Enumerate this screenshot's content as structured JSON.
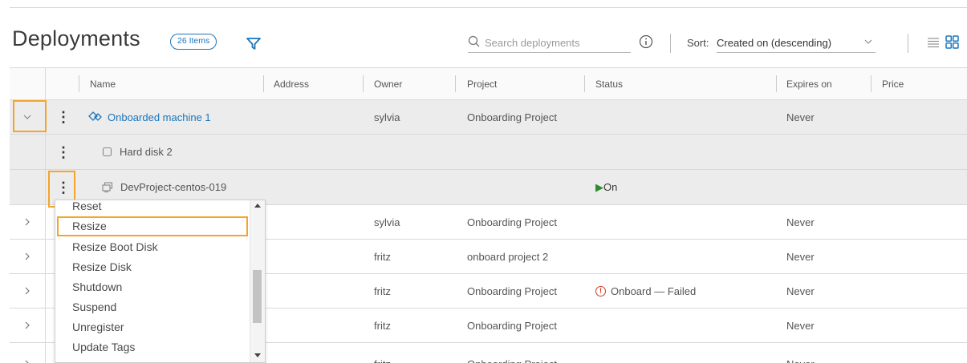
{
  "header": {
    "title": "Deployments",
    "count_badge": "26 Items",
    "search_placeholder": "Search deployments",
    "sort_label": "Sort:",
    "sort_value": "Created on (descending)"
  },
  "columns": [
    "Name",
    "Address",
    "Owner",
    "Project",
    "Status",
    "Expires on",
    "Price"
  ],
  "rows": [
    {
      "name": "Onboarded machine 1",
      "owner": "sylvia",
      "project": "Onboarding Project",
      "status": "",
      "expires": "Never"
    },
    {
      "name": "Hard disk 2"
    },
    {
      "name": "DevProject-centos-019",
      "status": "On"
    },
    {
      "owner": "sylvia",
      "project": "Onboarding Project",
      "status": "",
      "expires": "Never"
    },
    {
      "owner": "fritz",
      "project": "onboard project 2",
      "status": "",
      "expires": "Never"
    },
    {
      "owner": "fritz",
      "project": "Onboarding Project",
      "status": "Onboard — Failed",
      "expires": "Never"
    },
    {
      "owner": "fritz",
      "project": "Onboarding Project",
      "status": "",
      "expires": "Never"
    },
    {
      "owner": "fritz",
      "project": "Onboarding Project",
      "status": "",
      "expires": "Never"
    }
  ],
  "menu": {
    "items": [
      "Reset",
      "Resize",
      "Resize Boot Disk",
      "Resize Disk",
      "Shutdown",
      "Suspend",
      "Unregister",
      "Update Tags"
    ],
    "highlighted": "Resize"
  },
  "colors": {
    "accent": "#1b75bb",
    "highlight": "#f4a52b",
    "status_on": "#2e8b2e",
    "status_failed": "#d0391e"
  }
}
